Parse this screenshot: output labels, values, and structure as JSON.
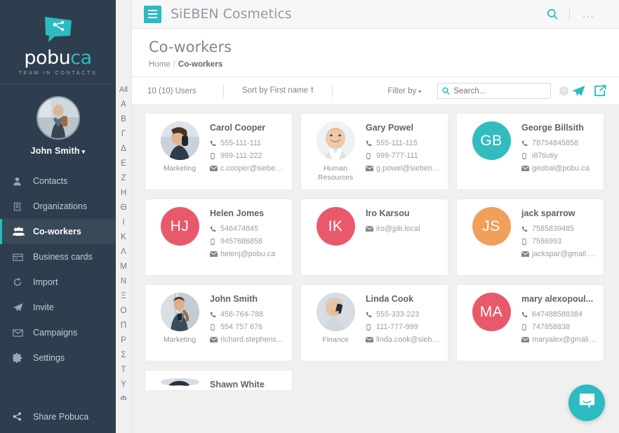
{
  "brand": {
    "logo_word_1": "pobu",
    "logo_word_2": "ca",
    "logo_tagline": "TEAM IN CONTACTS",
    "accent_color": "#2bbbc0",
    "sidebar_color": "#2e3e4e"
  },
  "profile": {
    "name": "John Smith",
    "caret": "▾"
  },
  "sidebar": {
    "items": [
      {
        "label": "Contacts",
        "icon": "user-icon",
        "active": false
      },
      {
        "label": "Organizations",
        "icon": "building-icon",
        "active": false
      },
      {
        "label": "Co-workers",
        "icon": "people-icon",
        "active": true
      },
      {
        "label": "Business cards",
        "icon": "card-icon",
        "active": false
      },
      {
        "label": "Import",
        "icon": "refresh-icon",
        "active": false
      },
      {
        "label": "Invite",
        "icon": "paper-plane-icon",
        "active": false
      },
      {
        "label": "Campaigns",
        "icon": "envelope-icon",
        "active": false
      },
      {
        "label": "Settings",
        "icon": "gear-icon",
        "active": false
      }
    ],
    "share": {
      "label": "Share Pobuca",
      "icon": "share-icon"
    }
  },
  "alphabet": [
    "All",
    "A",
    "B",
    "Γ",
    "Δ",
    "E",
    "Z",
    "H",
    "Θ",
    "I",
    "K",
    "Λ",
    "M",
    "N",
    "Ξ",
    "O",
    "Π",
    "P",
    "Σ",
    "T",
    "Y",
    "Φ"
  ],
  "topbar": {
    "menu_icon": "hamburger-icon",
    "organization": "SiEBEN Cosmetics",
    "search_icon": "search-icon",
    "more_icon": "ellipsis-icon",
    "more_label": "..."
  },
  "page": {
    "title": "Co-workers",
    "breadcrumb": {
      "home": "Home",
      "separator": "/",
      "current": "Co-workers"
    }
  },
  "toolbar": {
    "count_label": "10 (10) Users",
    "sort_label": "Sort by First name",
    "sort_arrow": "⭡",
    "filter_label": "Filter by",
    "filter_caret": "▾",
    "search_placeholder": "Search...",
    "search_value": "",
    "help_label": "?",
    "invite_icon": "paper-plane-icon",
    "export_icon": "export-icon"
  },
  "cards": [
    {
      "name": "Carol Cooper",
      "dept": "Marketing",
      "avatar_type": "photo",
      "photo": "woman-on-phone",
      "phone": "555-111-111",
      "mobile": "999-111-222",
      "email": "c.cooper@sieben..."
    },
    {
      "name": "Gary Powel",
      "dept": "Human Resources",
      "avatar_type": "photo",
      "photo": "smiling-man",
      "phone": "555-111-115",
      "mobile": "999-777-111",
      "email": "g.powel@siebenc..."
    },
    {
      "name": "George Billsith",
      "dept": "",
      "avatar_type": "initials",
      "initials": "GB",
      "initials_color": "#33bcbf",
      "phone": "78754845858",
      "mobile": "i87tiutiy",
      "email": "geobal@pobu.ca"
    },
    {
      "name": "Helen Jomes",
      "dept": "",
      "avatar_type": "initials",
      "initials": "HJ",
      "initials_color": "#e8596b",
      "phone": "546474845",
      "mobile": "9457686858",
      "email": "helenj@pobu.ca"
    },
    {
      "name": "Iro Karsou",
      "dept": "",
      "avatar_type": "initials",
      "initials": "IK",
      "initials_color": "#e8596b",
      "phone": "",
      "mobile": "",
      "email": "iro@jpb.local"
    },
    {
      "name": "jack sparrow",
      "dept": "",
      "avatar_type": "initials",
      "initials": "JS",
      "initials_color": "#f0a05a",
      "phone": "7585839485",
      "mobile": "7586993",
      "email": "jackspar@gmail.c..."
    },
    {
      "name": "John Smith",
      "dept": "Marketing",
      "avatar_type": "photo",
      "photo": "man-with-phone",
      "phone": "458-764-788",
      "mobile": "554 757 676",
      "email": "richard.stephens..."
    },
    {
      "name": "Linda Cook",
      "dept": "Finance",
      "avatar_type": "photo",
      "photo": "blonde-woman-phone",
      "phone": "555-333-223",
      "mobile": "111-777-999",
      "email": "linda.cook@siebe..."
    },
    {
      "name": "mary alexopoul...",
      "dept": "",
      "avatar_type": "initials",
      "initials": "MA",
      "initials_color": "#e8596b",
      "phone": "647488588384",
      "mobile": "747858838",
      "email": "maryalex@gmali...."
    },
    {
      "name": "Shawn White",
      "dept": "",
      "avatar_type": "photo",
      "photo": "woman-portrait",
      "phone": "",
      "mobile": "",
      "email": "",
      "clipped": true
    }
  ],
  "chat": {
    "icon": "chat-bubble-icon",
    "color": "#2bbbc0"
  }
}
